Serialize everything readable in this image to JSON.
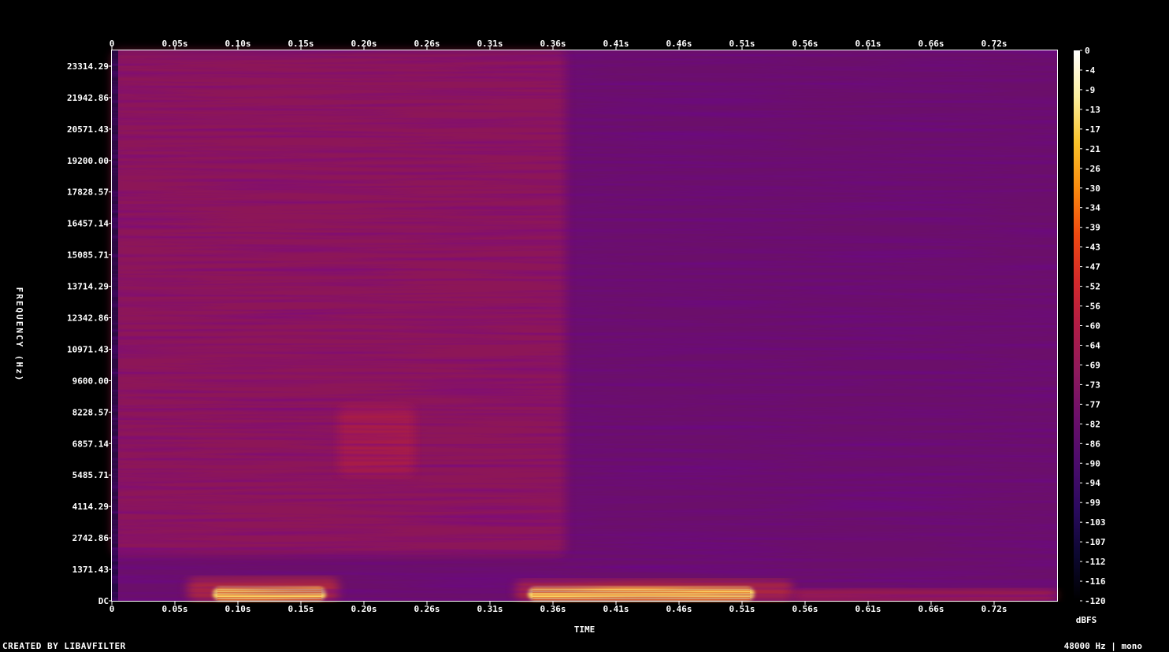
{
  "chart_data": {
    "type": "heatmap",
    "title": "",
    "xlabel": "TIME",
    "ylabel": "FREQUENCY (Hz)",
    "x_ticks": [
      "0",
      "0.05s",
      "0.10s",
      "0.15s",
      "0.20s",
      "0.26s",
      "0.31s",
      "0.36s",
      "0.41s",
      "0.46s",
      "0.51s",
      "0.56s",
      "0.61s",
      "0.66s",
      "0.72s"
    ],
    "y_ticks": [
      "DC",
      "1371.43",
      "2742.86",
      "4114.29",
      "5485.71",
      "6857.14",
      "8228.57",
      "9600.00",
      "10971.43",
      "12342.86",
      "13714.29",
      "15085.71",
      "16457.14",
      "17828.57",
      "19200.00",
      "20571.43",
      "21942.86",
      "23314.29"
    ],
    "xlim": [
      0,
      0.75
    ],
    "ylim": [
      0,
      24000
    ],
    "colorbar": {
      "label": "dBFS",
      "range": [
        -120,
        0
      ],
      "ticks": [
        "0",
        "-4",
        "-9",
        "-13",
        "-17",
        "-21",
        "-26",
        "-30",
        "-34",
        "-39",
        "-43",
        "-47",
        "-52",
        "-56",
        "-60",
        "-64",
        "-69",
        "-73",
        "-77",
        "-82",
        "-86",
        "-90",
        "-94",
        "-99",
        "-103",
        "-107",
        "-112",
        "-116",
        "-120"
      ],
      "colormap": [
        "#000000",
        "#0c0830",
        "#2a0a5e",
        "#4b0c6b",
        "#6b0f6a",
        "#8e1a5c",
        "#b01c45",
        "#d42a2a",
        "#f04a10",
        "#fb8b0e",
        "#fbc32a",
        "#fcf0a0",
        "#ffffff"
      ]
    },
    "grid": false,
    "legend": "colorbar right",
    "regions": [
      {
        "t_start": 0.0,
        "t_end": 0.75,
        "f_low": 0,
        "f_high": 24000,
        "dbfs": -80,
        "note": "background"
      },
      {
        "t_start": 0.0,
        "t_end": 0.36,
        "f_low": 2000,
        "f_high": 24000,
        "dbfs": -62
      },
      {
        "t_start": 0.06,
        "t_end": 0.18,
        "f_low": 0,
        "f_high": 1000,
        "dbfs": -45
      },
      {
        "t_start": 0.08,
        "t_end": 0.17,
        "f_low": 0,
        "f_high": 600,
        "dbfs": -15
      },
      {
        "t_start": 0.32,
        "t_end": 0.54,
        "f_low": 0,
        "f_high": 900,
        "dbfs": -45
      },
      {
        "t_start": 0.33,
        "t_end": 0.51,
        "f_low": 0,
        "f_high": 600,
        "dbfs": -15
      },
      {
        "t_start": 0.54,
        "t_end": 0.75,
        "f_low": 0,
        "f_high": 500,
        "dbfs": -50
      },
      {
        "t_start": 0.18,
        "t_end": 0.24,
        "f_low": 5500,
        "f_high": 8500,
        "dbfs": -56
      }
    ]
  },
  "footer": {
    "credit": "CREATED BY LIBAVFILTER",
    "format": "48000 Hz | mono"
  }
}
